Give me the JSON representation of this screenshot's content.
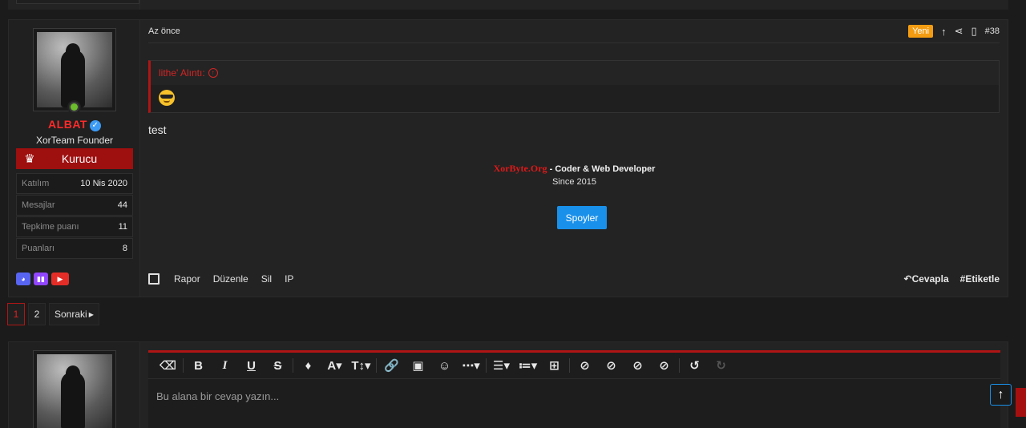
{
  "post": {
    "user": {
      "name": "ALBAT",
      "title": "XorTeam Founder",
      "banner": "Kurucu",
      "stats": [
        {
          "label": "Katılım",
          "value": "10 Nis 2020"
        },
        {
          "label": "Mesajlar",
          "value": "44"
        },
        {
          "label": "Tepkime puanı",
          "value": "11"
        },
        {
          "label": "Puanları",
          "value": "8"
        }
      ],
      "socials": [
        "discord-icon",
        "twitch-icon",
        "youtube-icon"
      ]
    },
    "time": "Az önce",
    "badge_new": "Yeni",
    "post_number": "#38",
    "quote": {
      "header": "lithe' Alıntı:",
      "emoji": "sunglasses-emoji"
    },
    "message": "test",
    "signature": {
      "brand": "XorByte.Org",
      "separator": " - ",
      "role": "Coder & Web Developer",
      "since": "Since 2015"
    },
    "spoiler_label": "Spoyler",
    "actions": {
      "report": "Rapor",
      "edit": "Düzenle",
      "delete": "Sil",
      "ip": "IP",
      "reply": "Cevapla",
      "tag": "Etiketle"
    }
  },
  "pagination": {
    "pages": [
      "1",
      "2"
    ],
    "current": "1",
    "next": "Sonraki"
  },
  "reply_editor": {
    "placeholder": "Bu alana bir cevap yazın..."
  },
  "colors": {
    "accent_red": "#b01515",
    "button_blue": "#1990ea",
    "new_badge": "#f39c12",
    "background": "#1b1b1b"
  }
}
